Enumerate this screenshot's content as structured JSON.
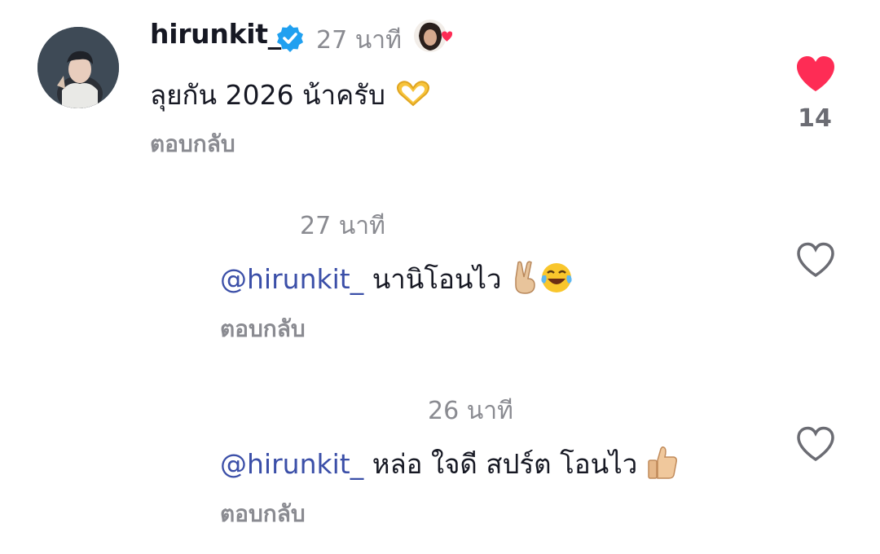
{
  "comment": {
    "username": "hirunkit_",
    "time": "27 นาที",
    "text": "ลุยกัน 2026 น้าครับ",
    "reply_label": "ตอบกลับ",
    "like_count": "14",
    "liked": true,
    "icons": [
      "avatar",
      "verified-badge-icon",
      "creator-liked-avatar",
      "heart-icon",
      "heart-hands-emoji"
    ]
  },
  "replies": [
    {
      "time": "27 นาที",
      "mention": "@hirunkit_",
      "text": "นานิโอนไว",
      "reply_label": "ตอบกลับ",
      "liked": false,
      "emojis": [
        "victory-hand-emoji",
        "tears-of-joy-emoji"
      ]
    },
    {
      "time": "26 นาที",
      "mention": "@hirunkit_",
      "text": "หล่อ ใจดี สปร์ต โอนไว",
      "reply_label": "ตอบกลับ",
      "liked": false,
      "emojis": [
        "thumbs-up-emoji"
      ]
    }
  ],
  "colors": {
    "like_red": "#fe2c55",
    "mention_blue": "#3b4fa8",
    "secondary_gray": "#8a8b91",
    "verified_blue": "#20d5ec"
  }
}
